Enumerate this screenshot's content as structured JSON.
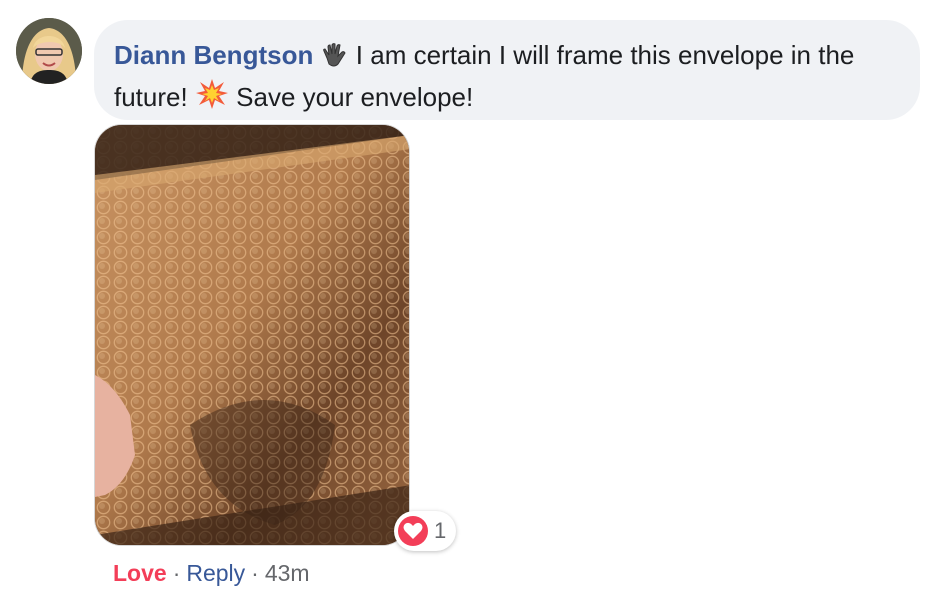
{
  "comment": {
    "author": "Diann Bengtson",
    "text_before_emoji": " I am certain I will frame this envelope in the future! ",
    "text_after_emoji": " Save your envelope!",
    "emoji_icons": [
      "waving-hand-icon",
      "collision-burst-icon"
    ]
  },
  "attachment": {
    "icon": "photo-gold-bubble-mailer"
  },
  "reactions": {
    "icon": "love-heart-icon",
    "count": "1",
    "color": "#f33e58"
  },
  "actions": {
    "love_label": "Love",
    "separator": "·",
    "reply_label": "Reply",
    "time": "43m"
  },
  "colors": {
    "author": "#385898",
    "bubble": "#f0f2f5",
    "love": "#f33e58",
    "muted": "#65676b"
  }
}
